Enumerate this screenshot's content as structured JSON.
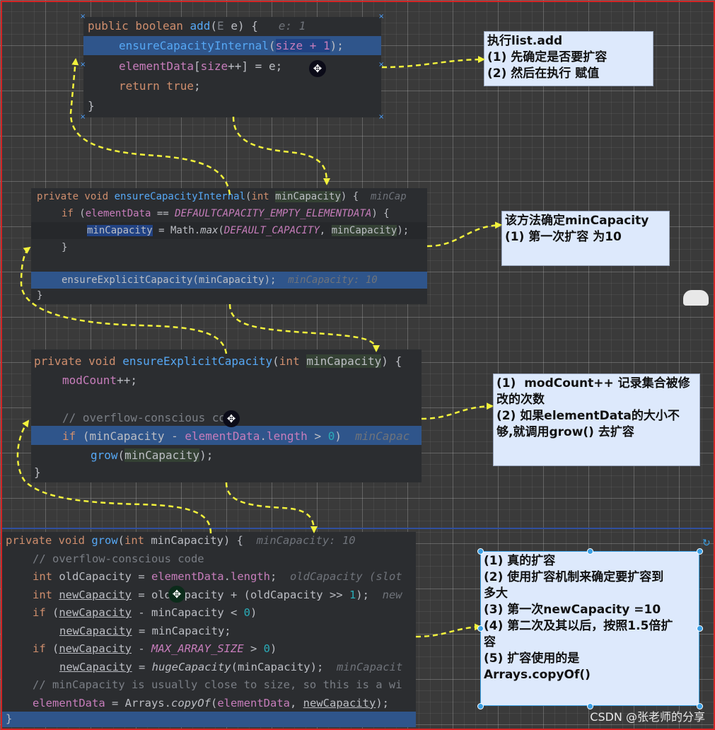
{
  "code_blocks": {
    "add": {
      "line1": {
        "kw": "public boolean ",
        "fn": "add",
        "open": "(",
        "param_type": "E",
        "rest": " e) {",
        "hint": "e: 1"
      },
      "line2": {
        "fn": "ensureCapacityInternal",
        "p1": "(",
        "sel": "size + 1",
        "p2": ");"
      },
      "line3": {
        "fld": "elementData",
        "rest1": "[",
        "fld2": "size",
        "rest2": "++] = e;"
      },
      "line4": {
        "kw": "return true",
        "rest": ";"
      },
      "line5": "}"
    },
    "ensure_internal": {
      "line1": {
        "kw": "private void ",
        "fn": "ensureCapacityInternal",
        "mid": "(",
        "kw2": "int ",
        "param": "minCapacity",
        "rest": ") {",
        "hint": "minCap"
      },
      "line2": {
        "kw": "if ",
        "p": "(",
        "fld": "elementData",
        "op": " == ",
        "cst": "DEFAULTCAPACITY_EMPTY_ELEMENTDATA",
        "rest": ") {"
      },
      "line3": {
        "sel": "minCapacity",
        "mid": " = Math.",
        "fn": "max",
        "p": "(",
        "cst": "DEFAULT_CAPACITY",
        "comma": ", ",
        "arg": "minCapacity",
        "rest": ");"
      },
      "line4": "}",
      "line5": {
        "text": "ensureExplicitCapacity(minCapacity);",
        "hint": "minCapacity: 10"
      },
      "line6": "}"
    },
    "ensure_explicit": {
      "line1": {
        "kw": "private void ",
        "fn": "ensureExplicitCapacity",
        "p": "(",
        "kw2": "int ",
        "param": "minCapacity",
        "rest": ") {"
      },
      "line2": {
        "fld": "modCount",
        "rest": "++;"
      },
      "line3": "// overflow-conscious code",
      "line4": {
        "kw": "if ",
        "p": "(minCapacity - ",
        "fld": "elementData",
        "dot": ".",
        "fld2": "length",
        "rest": " > ",
        "num": "0",
        "close": ")",
        "hint": "minCapac"
      },
      "line5": {
        "fn": "grow",
        "p": "(",
        "arg": "minCapacity",
        "rest": ");"
      },
      "line6": "}"
    },
    "grow": {
      "line1": {
        "kw": "private void ",
        "fn": "grow",
        "p": "(",
        "kw2": "int ",
        "rest": "minCapacity) {",
        "hint": "minCapacity: 10"
      },
      "line2": "// overflow-conscious code",
      "line3": {
        "kw": "int ",
        "var": "oldCapacity",
        "op": " = ",
        "fld": "elementData",
        "dot": ".",
        "fld2": "length",
        "semi": ";",
        "hint": "oldCapacity (slot"
      },
      "line4": {
        "kw": "int ",
        "var": "newCapacity",
        "rest": " = oldCapacity + (oldCapacity >> ",
        "num": "1",
        "semi": ");",
        "hint": "new"
      },
      "line5": {
        "kw": "if ",
        "p": "(",
        "var": "newCapacity",
        "rest": " - minCapacity < ",
        "num": "0",
        "close": ")"
      },
      "line6": {
        "var": "newCapacity",
        "rest": " = minCapacity;"
      },
      "line7": {
        "kw": "if ",
        "p": "(",
        "var": "newCapacity",
        "op": " - ",
        "cst": "MAX_ARRAY_SIZE",
        "rest": " > ",
        "num": "0",
        "close": ")"
      },
      "line8": {
        "var": "newCapacity",
        "mid": " = ",
        "fn": "hugeCapacity",
        "rest": "(minCapacity);",
        "hint": "minCapacit"
      },
      "line9": "// minCapacity is usually close to size, so this is a wi",
      "line10": {
        "fld": "elementData",
        "mid": " = Arrays.",
        "fn": "copyOf",
        "p": "(",
        "fld2": "elementData",
        "comma": ", ",
        "var": "newCapacity",
        "rest": ");"
      },
      "line11": "}"
    }
  },
  "notes": {
    "note1": [
      "执行list.add",
      "(1) 先确定是否要扩容",
      "(2) 然后在执行 赋值"
    ],
    "note2": [
      "该方法确定minCapacity",
      "(1) 第一次扩容 为10"
    ],
    "note3": [
      "(1)  modCount++ 记录集合被修",
      "改的次数",
      "(2) 如果elementData的大小不",
      "够,就调用grow() 去扩容"
    ],
    "note4": [
      "(1) 真的扩容",
      "(2) 使用扩容机制来确定要扩容到",
      "多大",
      "(3) 第一次newCapacity =10",
      "(4) 第二次及其以后，按照1.5倍扩",
      "容",
      "(5) 扩容使用的是",
      "Arrays.copyOf()"
    ]
  },
  "watermark": "CSDN @张老师的分享",
  "colors": {
    "arrow": "#f2f23c",
    "frame": "#d42424",
    "code_bg": "#2b2d30",
    "note_bg": "#dde9fc",
    "line_highlight": "#2f558b"
  }
}
